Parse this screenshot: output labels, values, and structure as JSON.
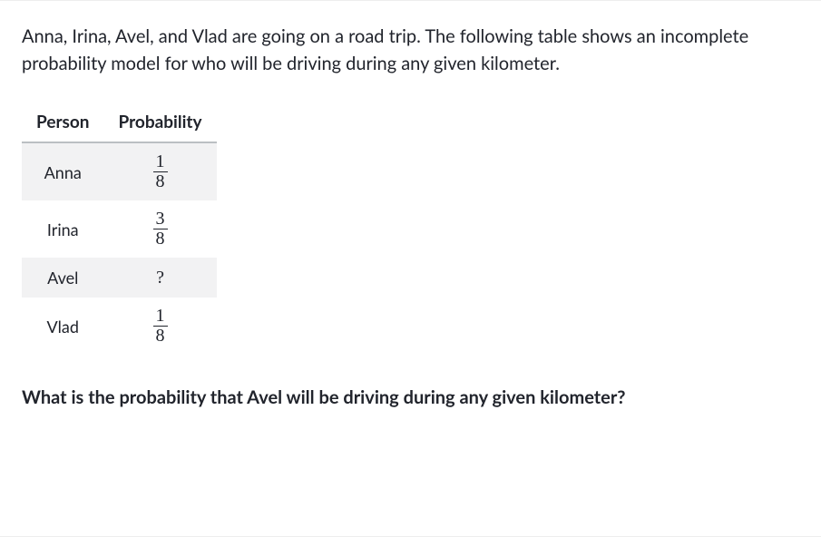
{
  "intro": "Anna, Irina, Avel, and Vlad are going on a road trip. The following table shows an incomplete probability model for who will be driving during any given kilometer.",
  "table": {
    "headers": {
      "person": "Person",
      "probability": "Probability"
    },
    "rows": [
      {
        "person": "Anna",
        "num": "1",
        "den": "8",
        "text": ""
      },
      {
        "person": "Irina",
        "num": "3",
        "den": "8",
        "text": ""
      },
      {
        "person": "Avel",
        "num": "",
        "den": "",
        "text": "?"
      },
      {
        "person": "Vlad",
        "num": "1",
        "den": "8",
        "text": ""
      }
    ]
  },
  "question": "What is the probability that Avel will be driving during any given kilometer?"
}
